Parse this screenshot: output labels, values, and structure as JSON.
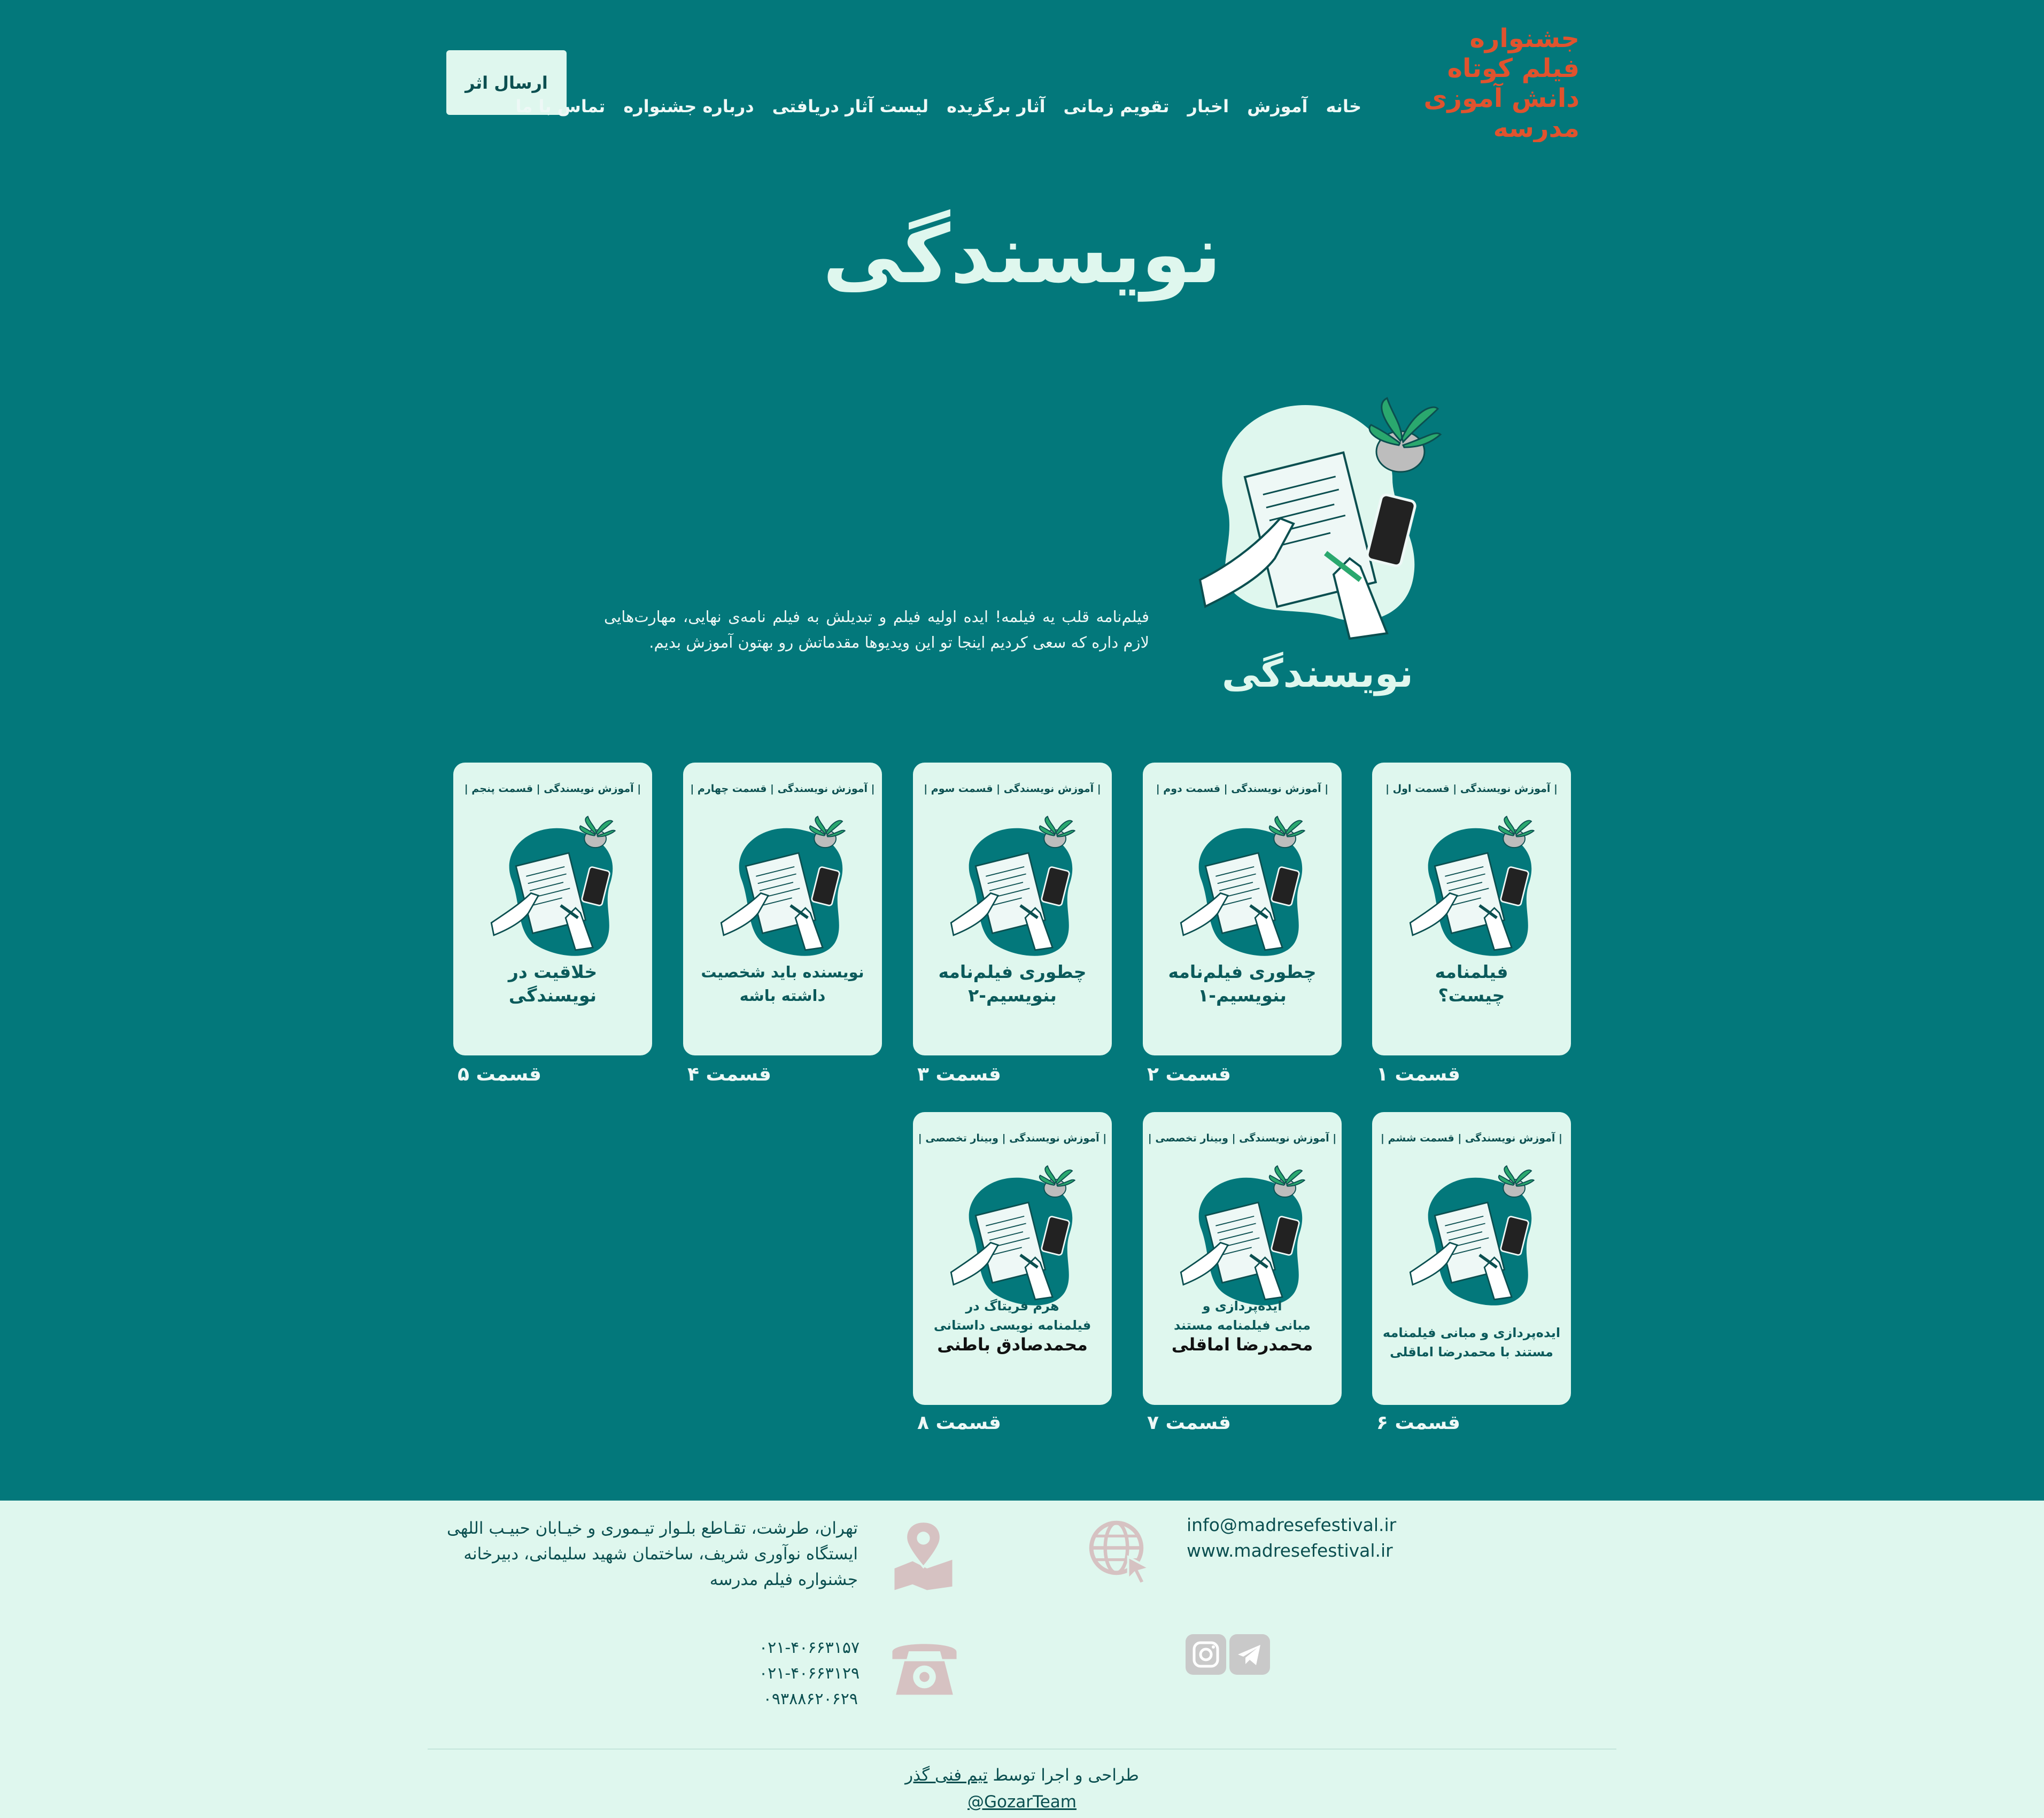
{
  "header": {
    "logo_lines": [
      "جشنواره",
      "فیلم کوتاه",
      "دانش آموزی",
      "مدرسه"
    ],
    "submit_label": "ارسال اثر",
    "nav": [
      "خانه",
      "آموزش",
      "اخبار",
      "تقویم زمانی",
      "آثار برگزیده",
      "لیست آثار دریافتی",
      "درباره جشنواره",
      "تماس با ما"
    ]
  },
  "page_title": "نویسندگی",
  "hero": {
    "illus_caption": "نویسندگی",
    "text": "فیلم‌نامه قلب یه فیلمه! ایده اولیه فیلم و تبدیلش به فیلم نامه‌ی نهایی، مهارت‌هایی لازم داره که سعی کردیم اینجا تو این ویدیوها مقدماتش رو بهتون آموزش بدیم."
  },
  "episodes": [
    {
      "top": "| آموزش نویسندگی | قسمت اول |",
      "title": [
        "فیلمنامه",
        "چیست؟"
      ],
      "label": "قسمت ۱"
    },
    {
      "top": "| آموزش نویسندگی | قسمت دوم |",
      "title": [
        "چطوری فیلم‌نامه",
        "بنویسیم-۱"
      ],
      "label": "قسمت ۲"
    },
    {
      "top": "| آموزش نویسندگی | قسمت سوم |",
      "title": [
        "چطوری فیلم‌نامه",
        "بنویسیم-۲"
      ],
      "label": "قسمت ۳"
    },
    {
      "top": "| آموزش نویسندگی | قسمت چهارم |",
      "title": [
        "نویسنده باید شخصیت",
        "داشته باشه"
      ],
      "label": "قسمت ۴"
    },
    {
      "top": "| آموزش نویسندگی | قسمت پنجم |",
      "title": [
        "خلاقیت در",
        "نویسندگی"
      ],
      "label": "قسمت ۵"
    },
    {
      "top": "| آموزش نویسندگی | قسمت ششم |",
      "title": [
        "ایده‌پردازی و مبانی فیلمنامه",
        "مستند با محمدرضا اماقلی"
      ],
      "label": "قسمت ۶"
    },
    {
      "top": "| آموزش نویسندگی | وبینار تخصصی |",
      "title": [
        "ایده‌پردازی و",
        "مبانی فیلمنامه مستند",
        "محمدرضا اماقلی"
      ],
      "label": "قسمت ۷"
    },
    {
      "top": "| آموزش نویسندگی | وبینار تخصصی |",
      "title": [
        "هرم فریتاگ در",
        "فیلمنامه نویسی داستانی",
        "محمدصادق باطنی"
      ],
      "label": "قسمت ۸"
    }
  ],
  "footer": {
    "email": "info@madresefestival.ir",
    "website": "www.madresefestival.ir",
    "address": "تهران، طرشت، تقـاطع بلـوار تیـموری و خیـابان حبیـب اللهی ایستگاه نوآوری شریف، ساختمان شهید سلیمانی، دبیرخانه جشنواره فیلم مدرسه",
    "phones": [
      "۰۲۱-۴۰۶۶۳۱۵۷",
      "۰۲۱-۴۰۶۶۳۱۲۹",
      "۰۹۳۸۸۶۲۰۶۲۹"
    ],
    "credit_prefix": "طراحی و اجرا توسط",
    "credit_link": "تیم فنی گذر",
    "handle": "@GozarTeam"
  },
  "icons": [
    "globe-cursor-icon",
    "map-pin-icon",
    "telephone-icon",
    "telegram-icon",
    "instagram-icon"
  ],
  "colors": {
    "background": "#03787b",
    "mint": "#dff7ee",
    "logo_orange": "#e0532e",
    "dark_teal": "#0b4f50"
  }
}
